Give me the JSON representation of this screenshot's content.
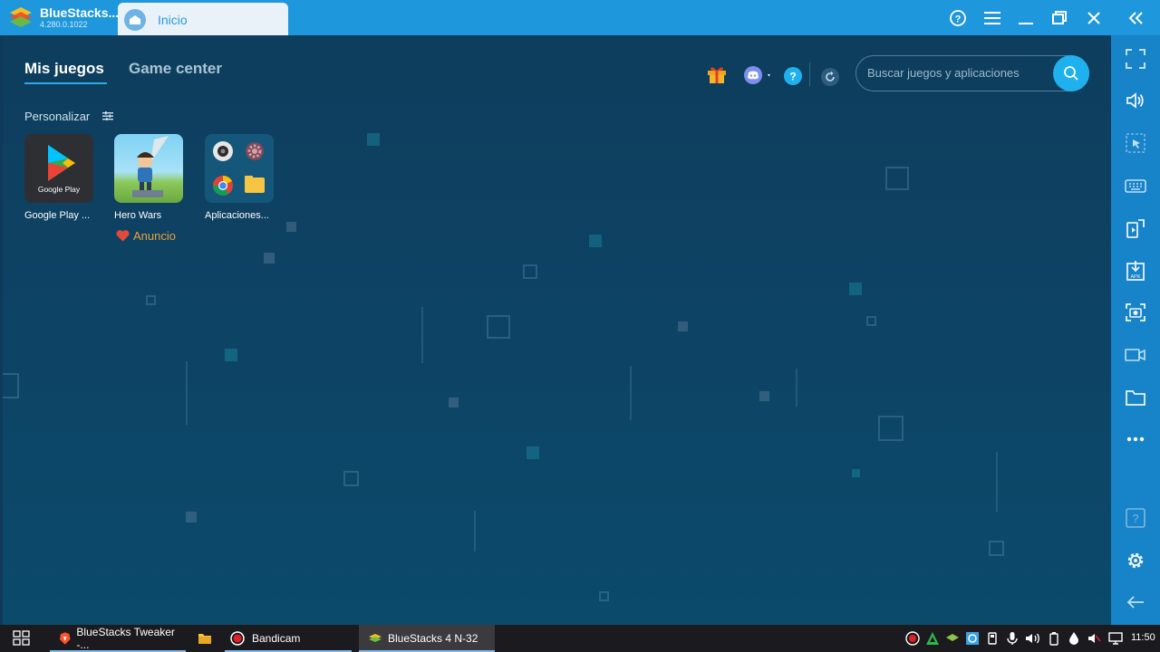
{
  "window": {
    "app_name": "BlueStacks...",
    "app_version": "4.280.0.1022",
    "home_tab_label": "Inicio"
  },
  "nav": {
    "tabs": [
      {
        "label": "Mis juegos",
        "active": true
      },
      {
        "label": "Game center",
        "active": false
      }
    ],
    "personalize_label": "Personalizar"
  },
  "apps": [
    {
      "label": "Google Play ...",
      "icon": "google-play-icon",
      "caption": "Google Play"
    },
    {
      "label": "Hero Wars",
      "icon": "hero-wars-icon",
      "badge": "Anuncio"
    },
    {
      "label": "Aplicaciones...",
      "icon": "system-apps-folder-icon"
    }
  ],
  "search": {
    "placeholder": "Buscar juegos y aplicaciones"
  },
  "taskbar": {
    "items": [
      {
        "label": "BlueStacks Tweaker -...",
        "icon": "brave-icon"
      },
      {
        "label": "",
        "icon": "file-explorer-icon"
      },
      {
        "label": "Bandicam",
        "icon": "bandicam-icon"
      },
      {
        "label": "BlueStacks 4 N-32",
        "icon": "bluestacks-icon",
        "active": true
      }
    ],
    "clock": "11:50"
  },
  "colors": {
    "titlebar": "#1f97dc",
    "sidebar": "#1783c9",
    "accent": "#1fb1ee",
    "ad_text": "#e8a23c"
  }
}
